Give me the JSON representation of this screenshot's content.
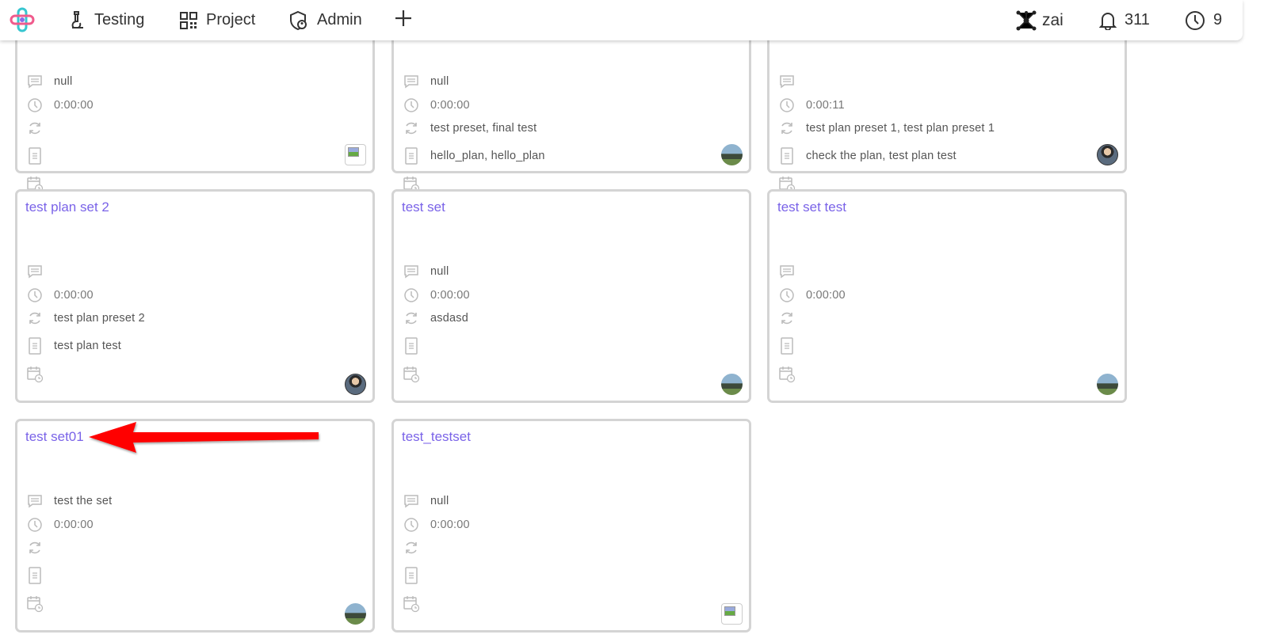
{
  "topbar": {
    "nav": [
      {
        "label": "Testing",
        "icon": "microscope-icon"
      },
      {
        "label": "Project",
        "icon": "qr-grid-icon"
      },
      {
        "label": "Admin",
        "icon": "shield-user-icon"
      }
    ],
    "add_icon": "plus-icon",
    "user": {
      "label": "zai",
      "icon": "network-icon"
    },
    "notifications": {
      "count": "311",
      "icon": "bell-icon"
    },
    "timers": {
      "count": "9",
      "icon": "clock-icon"
    }
  },
  "cards": [
    {
      "title": "",
      "description": "null",
      "duration": "0:00:00",
      "presets": "",
      "plans": "",
      "avatar": "broken"
    },
    {
      "title": "",
      "description": "null",
      "duration": "0:00:00",
      "presets": "test preset, final test",
      "plans": "hello_plan, hello_plan",
      "avatar": "landscape"
    },
    {
      "title": "",
      "description": "",
      "duration": "0:00:11",
      "presets": "test plan preset 1, test plan preset 1",
      "plans": "check the plan, test plan test",
      "avatar": "photo"
    },
    {
      "title": "test plan set 2",
      "description": "",
      "duration": "0:00:00",
      "presets": "test plan preset 2",
      "plans": "test plan test",
      "avatar": "photo"
    },
    {
      "title": "test set",
      "description": "null",
      "duration": "0:00:00",
      "presets": "asdasd",
      "plans": "",
      "avatar": "landscape"
    },
    {
      "title": "test set test",
      "description": "",
      "duration": "0:00:00",
      "presets": "",
      "plans": "",
      "avatar": "landscape"
    },
    {
      "title": "test set01",
      "description": "test the set",
      "duration": "0:00:00",
      "presets": "",
      "plans": "",
      "avatar": "landscape"
    },
    {
      "title": "test_testset",
      "description": "null",
      "duration": "0:00:00",
      "presets": "",
      "plans": "",
      "avatar": "broken"
    }
  ],
  "colors": {
    "title": "#7a63e8",
    "arrow": "#ff0000",
    "border": "#d4d4d4"
  }
}
